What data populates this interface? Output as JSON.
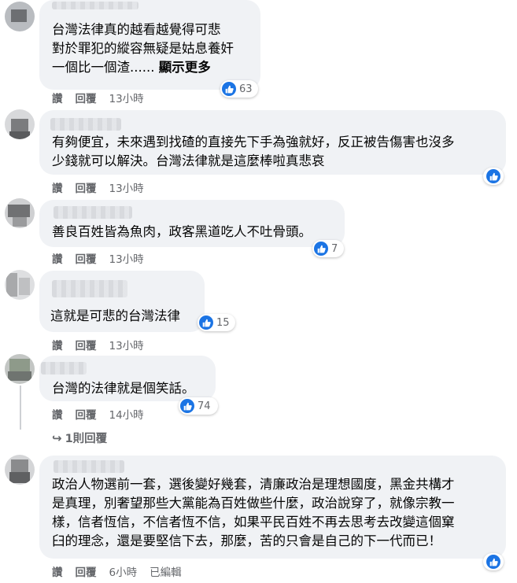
{
  "comments": [
    {
      "text": "台灣法律真的越看越覺得可悲\n對於罪犯的縱容無疑是姑息養奸\n一個比一個渣...... ",
      "see_more": "顯示更多",
      "reactions": "63",
      "actions": {
        "like": "讚",
        "reply": "回覆",
        "time": "13小時"
      }
    },
    {
      "text": "有夠便宜，未來遇到找碴的直接先下手為強就好，反正被告傷害也沒多\n少錢就可以解決。台灣法律就是這麼棒啦真悲哀",
      "reactions": "",
      "actions": {
        "like": "讚",
        "reply": "回覆",
        "time": "13小時"
      }
    },
    {
      "text": "善良百姓皆為魚肉，政客黑道吃人不吐骨頭。",
      "reactions": "7",
      "actions": {
        "like": "讚",
        "reply": "回覆",
        "time": "13小時"
      }
    },
    {
      "text": "這就是可悲的台灣法律",
      "reactions": "15",
      "actions": {
        "like": "讚",
        "reply": "回覆",
        "time": "13小時"
      }
    },
    {
      "text": "台灣的法律就是個笑話。",
      "reactions": "74",
      "actions": {
        "like": "讚",
        "reply": "回覆",
        "time": "14小時"
      },
      "replies_link": "1則回覆"
    },
    {
      "text": "政治人物選前一套，選後變好幾套，清廉政治是理想國度，黑金共構才\n是真理，別奢望那些大黨能為百姓做些什麼，政治說穿了，就像宗教一\n樣，信者恆信，不信者恆不信，如果平民百姓不再去思考去改變這個窠\n臼的理念，還是要堅信下去，那麼，苦的只會是自己的下一代而已！",
      "reactions": "",
      "actions": {
        "like": "讚",
        "reply": "回覆",
        "time": "6小時",
        "edited": "已編輯"
      }
    }
  ],
  "colors": {
    "like_blue": "#1b74e4",
    "bubble": "#f0f2f5",
    "meta_gray": "#65676b"
  }
}
